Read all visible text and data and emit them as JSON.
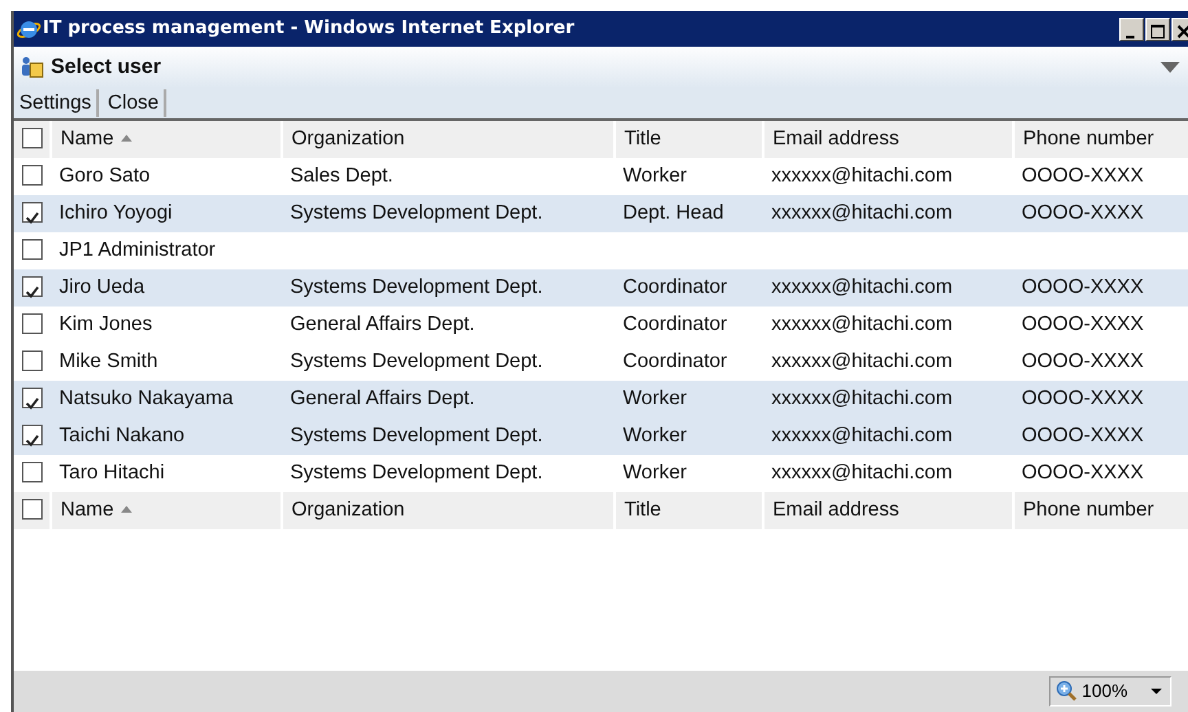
{
  "window": {
    "title": "IT process management - Windows Internet Explorer"
  },
  "page_header": {
    "title": "Select user"
  },
  "toolbar": [
    "Settings",
    "Close"
  ],
  "table": {
    "header_checked": false,
    "columns": [
      "Name",
      "Organization",
      "Title",
      "Email address",
      "Phone number"
    ],
    "rows": [
      {
        "checked": false,
        "cells": [
          "Goro Sato",
          "Sales Dept.",
          "Worker",
          "xxxxxx@hitachi.com",
          "OOOO-XXXX"
        ]
      },
      {
        "checked": true,
        "cells": [
          "Ichiro Yoyogi",
          "Systems Development Dept.",
          "Dept. Head",
          "xxxxxx@hitachi.com",
          "OOOO-XXXX"
        ]
      },
      {
        "checked": false,
        "cells": [
          "JP1 Administrator",
          "",
          "",
          "",
          ""
        ]
      },
      {
        "checked": true,
        "cells": [
          "Jiro Ueda",
          "Systems Development Dept.",
          "Coordinator",
          "xxxxxx@hitachi.com",
          "OOOO-XXXX"
        ]
      },
      {
        "checked": false,
        "cells": [
          "Kim Jones",
          "General Affairs Dept.",
          "Coordinator",
          "xxxxxx@hitachi.com",
          "OOOO-XXXX"
        ]
      },
      {
        "checked": false,
        "cells": [
          "Mike Smith",
          "Systems Development Dept.",
          "Coordinator",
          "xxxxxx@hitachi.com",
          "OOOO-XXXX"
        ]
      },
      {
        "checked": true,
        "cells": [
          "Natsuko Nakayama",
          "General Affairs Dept.",
          "Worker",
          "xxxxxx@hitachi.com",
          "OOOO-XXXX"
        ]
      },
      {
        "checked": true,
        "cells": [
          "Taichi Nakano",
          "Systems Development Dept.",
          "Worker",
          "xxxxxx@hitachi.com",
          "OOOO-XXXX"
        ]
      },
      {
        "checked": false,
        "cells": [
          "Taro Hitachi",
          "Systems Development Dept.",
          "Worker",
          "xxxxxx@hitachi.com",
          "OOOO-XXXX"
        ]
      }
    ],
    "footer_checked": false,
    "footer_columns": [
      "Name",
      "Organization",
      "Title",
      "Email address",
      "Phone number"
    ]
  },
  "status_bar": {
    "zoom": "100%"
  }
}
